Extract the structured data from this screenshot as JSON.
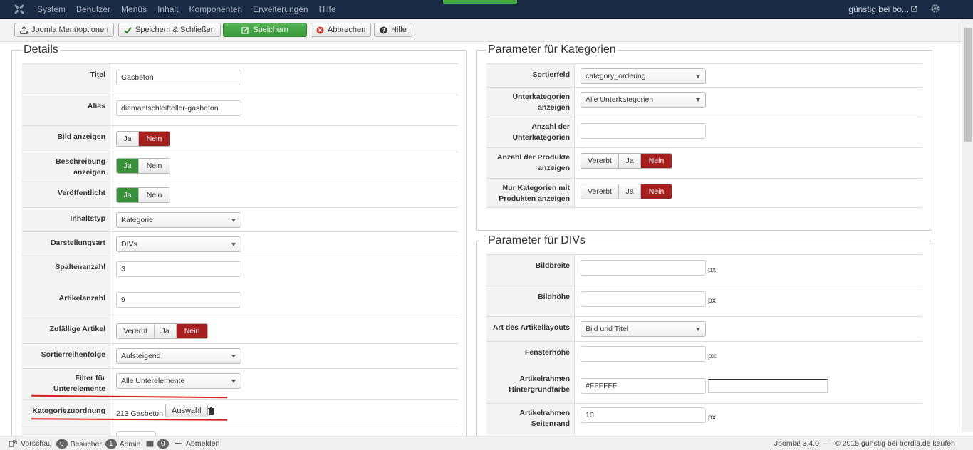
{
  "topbar": {
    "menu": [
      "System",
      "Benutzer",
      "Menüs",
      "Inhalt",
      "Komponenten",
      "Erweiterungen",
      "Hilfe"
    ],
    "site_name": "günstig bei bo..."
  },
  "toolbar": {
    "menu_options": "Joomla Menüoptionen",
    "save_close": "Speichern & Schließen",
    "save": "Speichern",
    "cancel": "Abbrechen",
    "help": "Hilfe"
  },
  "details": {
    "legend": "Details",
    "title_label": "Titel",
    "title_value": "Gasbeton",
    "alias_label": "Alias",
    "alias_value": "diamantschleifteller-gasbeton",
    "show_image_label": "Bild anzeigen",
    "desc_label_1": "Beschreibung",
    "desc_label_2": "anzeigen",
    "published_label": "Veröffentlicht",
    "content_type_label": "Inhaltstyp",
    "content_type_value": "Kategorie",
    "display_label": "Darstellungsart",
    "display_value": "DIVs",
    "columns_label": "Spaltenanzahl",
    "columns_value": "3",
    "articles_label": "Artikelanzahl",
    "articles_value": "9",
    "random_label": "Zufällige Artikel",
    "sort_label": "Sortierreihenfolge",
    "sort_value": "Aufsteigend",
    "filter_label_1": "Filter für",
    "filter_label_2": "Unterelemente",
    "filter_value": "Alle Unterelemente",
    "cat_assign_label": "Kategoriezuordnung",
    "cat_assign_value": "213 Gasbeton",
    "select_button": "Auswahl",
    "yes": "Ja",
    "no": "Nein",
    "inherited": "Vererbt"
  },
  "category_params": {
    "legend": "Parameter für Kategorien",
    "sortfield_label": "Sortierfeld",
    "sortfield_value": "category_ordering",
    "subcats_label_1": "Unterkategorien",
    "subcats_label_2": "anzeigen",
    "subcats_value": "Alle Unterkategorien",
    "subcat_count_label_1": "Anzahl der",
    "subcat_count_label_2": "Unterkategorien",
    "subcat_count_value": "",
    "product_count_label_1": "Anzahl der Produkte",
    "product_count_label_2": "anzeigen",
    "only_with_products_label_1": "Nur Kategorien mit",
    "only_with_products_label_2": "Produkten anzeigen"
  },
  "div_params": {
    "legend": "Parameter für DIVs",
    "img_width_label": "Bildbreite",
    "img_height_label": "Bildhöhe",
    "layout_label": "Art des Artikellayouts",
    "layout_value": "Bild und Titel",
    "window_height_label": "Fensterhöhe",
    "bg_color_label_1": "Artikelrahmen",
    "bg_color_label_2": "Hintergrundfarbe",
    "bg_color_value": "#FFFFFF",
    "margin_label_1": "Artikelrahmen",
    "margin_label_2": "Seitenrand",
    "margin_value": "10",
    "unit": "px"
  },
  "statusbar": {
    "preview": "Vorschau",
    "visitors_count": "0",
    "visitors": "Besucher",
    "admin_count": "1",
    "admin": "Admin",
    "messages_count": "0",
    "logout": "Abmelden",
    "footer": "Joomla! 3.4.0  —  © 2015 günstig bei bordia.de kaufen"
  },
  "colors": {
    "topbar": "#1a2b45",
    "green": "#3a8f3a",
    "red": "#a51f1f",
    "annotation": "#d81f1f"
  }
}
